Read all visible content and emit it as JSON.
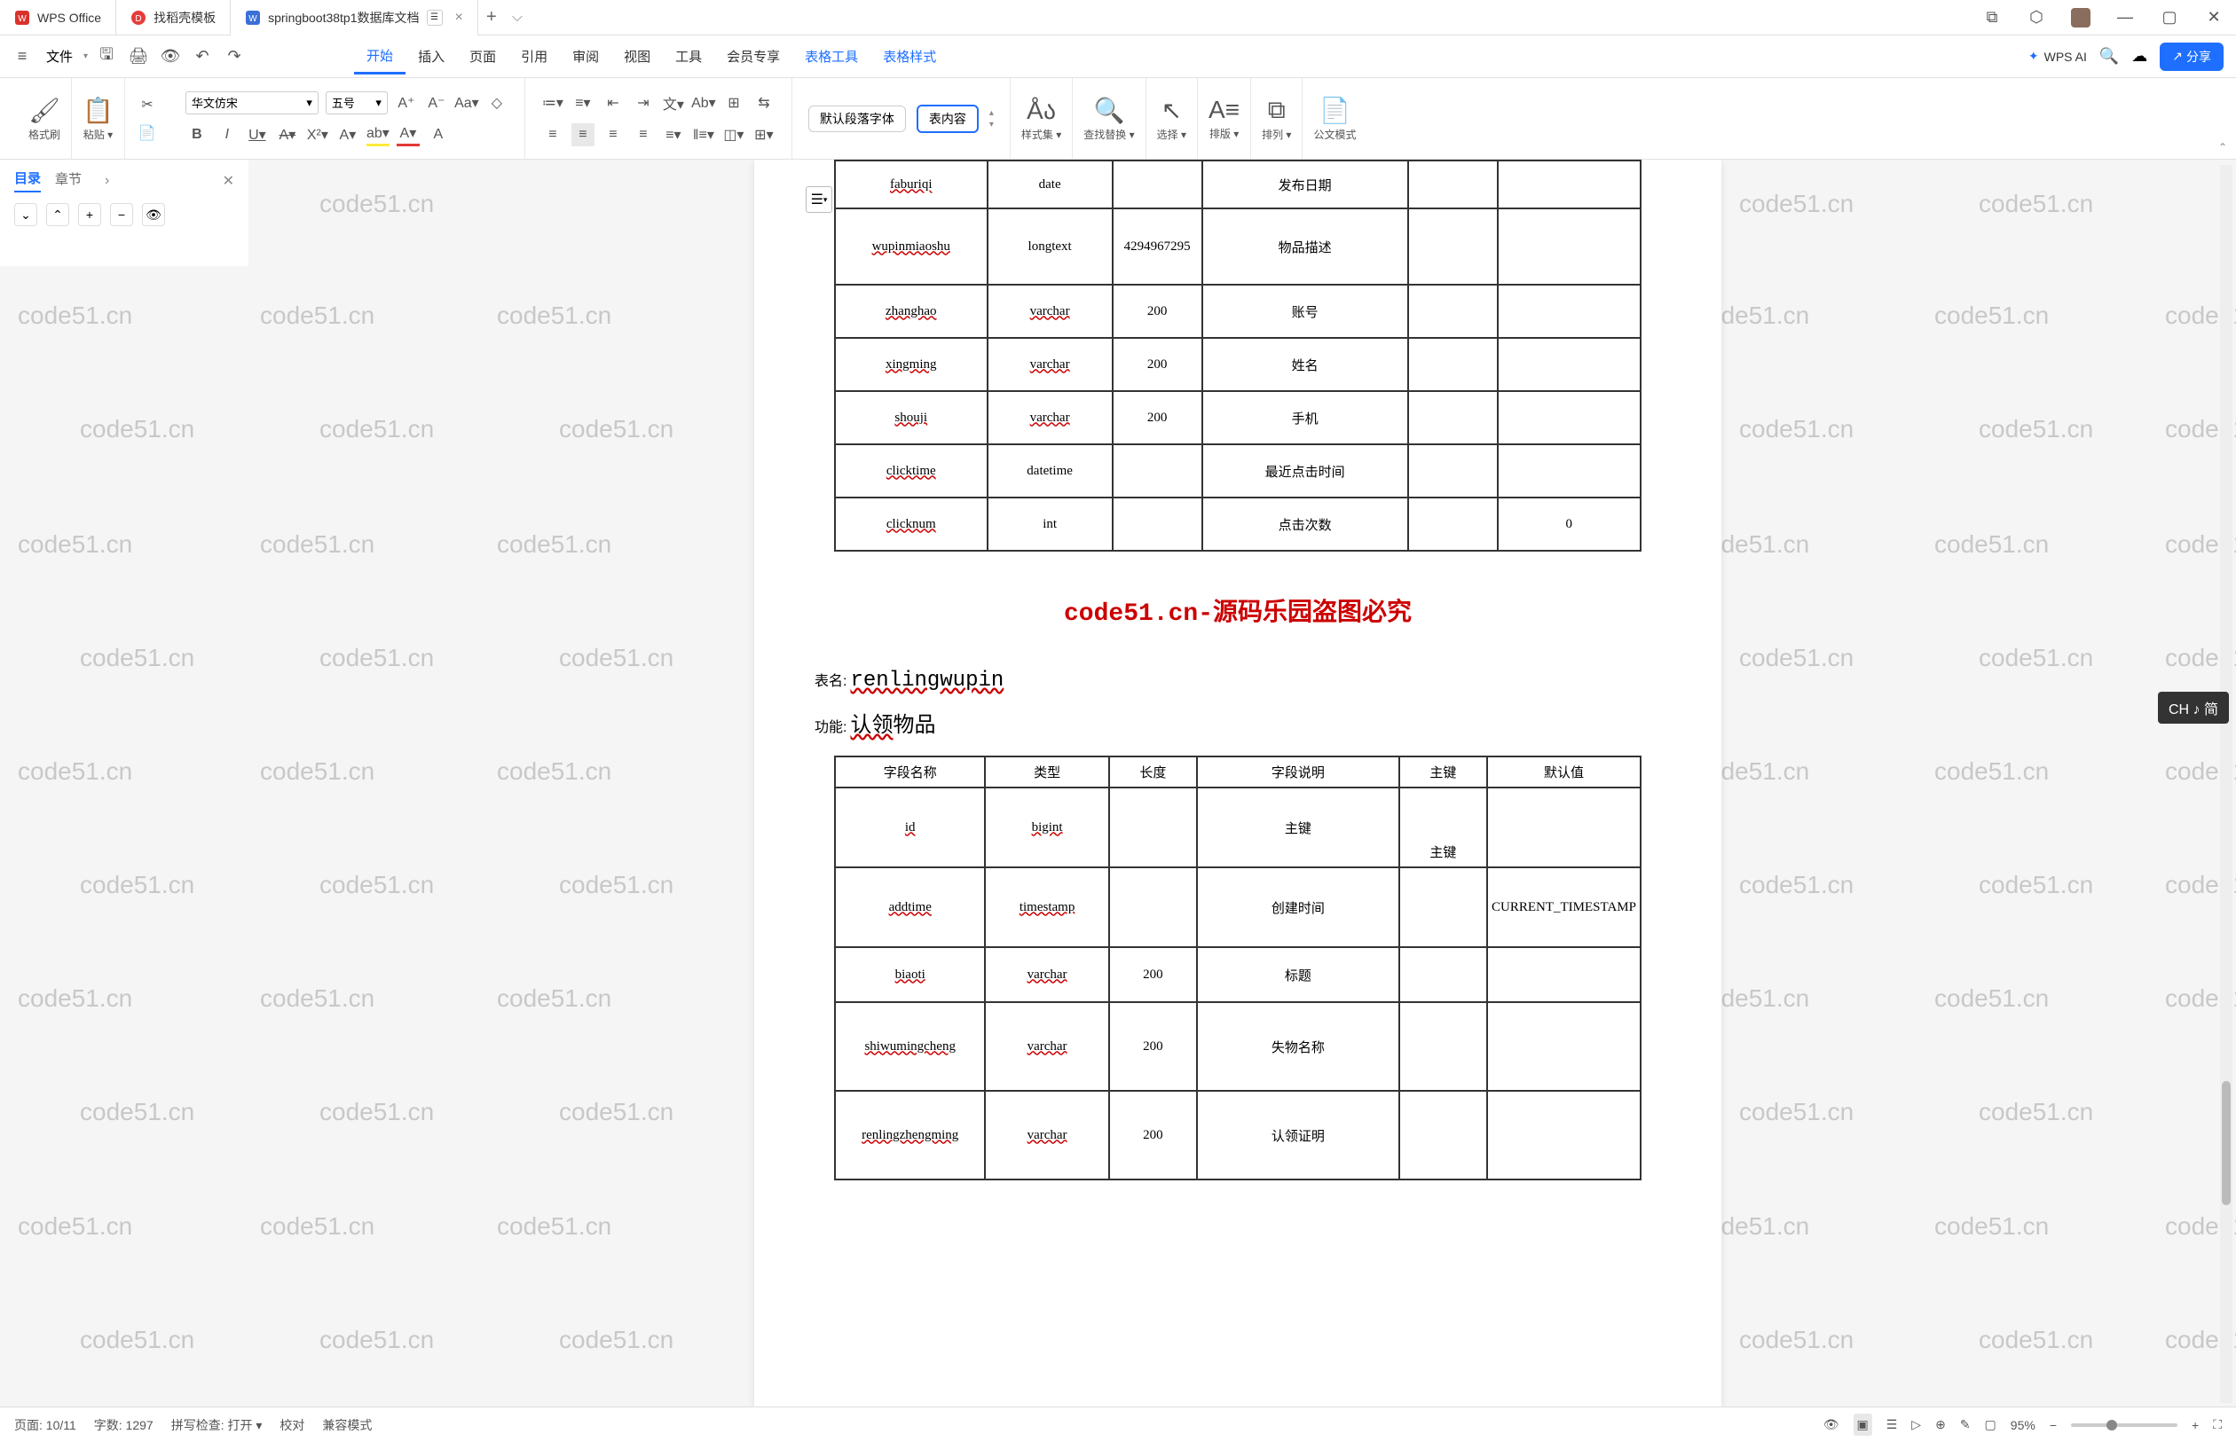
{
  "titlebar": {
    "tabs": [
      {
        "label": "WPS Office",
        "icon": "wps"
      },
      {
        "label": "找稻壳模板",
        "icon": "docer"
      },
      {
        "label": "springboot38tp1数据库文档",
        "icon": "doc",
        "active": true
      }
    ],
    "newTab": "+"
  },
  "menu": {
    "fileLabel": "文件",
    "items": [
      "开始",
      "插入",
      "页面",
      "引用",
      "审阅",
      "视图",
      "工具",
      "会员专享",
      "表格工具",
      "表格样式"
    ],
    "activeIndex": 0,
    "blueIndices": [
      8,
      9
    ],
    "wpsAI": "WPS AI",
    "share": "分享"
  },
  "ribbon": {
    "formatBrush": "格式刷",
    "paste": "粘贴",
    "fontName": "华文仿宋",
    "fontSize": "五号",
    "defaultPara": "默认段落字体",
    "tableContent": "表内容",
    "styleSet": "样式集",
    "findReplace": "查找替换",
    "select": "选择",
    "layout": "排版",
    "arrange": "排列",
    "writingMode": "公文模式"
  },
  "sidepanel": {
    "tabs": [
      "目录",
      "章节"
    ],
    "activeIndex": 0
  },
  "document": {
    "table1": {
      "rows": [
        {
          "name": "faburiqi",
          "type": "date",
          "len": "",
          "desc": "发布日期",
          "pk": "",
          "def": ""
        },
        {
          "name": "wupinmiaoshu",
          "type": "longtext",
          "len": "4294967295",
          "desc": "物品描述",
          "pk": "",
          "def": ""
        },
        {
          "name": "zhanghao",
          "type": "varchar",
          "len": "200",
          "desc": "账号",
          "pk": "",
          "def": ""
        },
        {
          "name": "xingming",
          "type": "varchar",
          "len": "200",
          "desc": "姓名",
          "pk": "",
          "def": ""
        },
        {
          "name": "shouji",
          "type": "varchar",
          "len": "200",
          "desc": "手机",
          "pk": "",
          "def": ""
        },
        {
          "name": "clicktime",
          "type": "datetime",
          "len": "",
          "desc": "最近点击时间",
          "pk": "",
          "def": ""
        },
        {
          "name": "clicknum",
          "type": "int",
          "len": "",
          "desc": "点击次数",
          "pk": "",
          "def": "0"
        }
      ]
    },
    "heading": "code51.cn-源码乐园盗图必究",
    "tableNameLabel": "表名:",
    "tableNameValue": "renlingwupin",
    "funcLabel": "功能:",
    "funcPrefix": "认领",
    "funcSuffix": "物品",
    "table2": {
      "headers": [
        "字段名称",
        "类型",
        "长度",
        "字段说明",
        "主键",
        "默认值"
      ],
      "rows": [
        {
          "name": "id",
          "type": "bigint",
          "len": "",
          "desc": "主键",
          "pk": "主键",
          "def": ""
        },
        {
          "name": "addtime",
          "type": "timestamp",
          "len": "",
          "desc": "创建时间",
          "pk": "",
          "def": "CURRENT_TIMESTAMP"
        },
        {
          "name": "biaoti",
          "type": "varchar",
          "len": "200",
          "desc": "标题",
          "pk": "",
          "def": ""
        },
        {
          "name": "shiwumingcheng",
          "type": "varchar",
          "len": "200",
          "desc": "失物名称",
          "pk": "",
          "def": ""
        },
        {
          "name": "renlingzhengming",
          "type": "varchar",
          "len": "200",
          "desc": "认领证明",
          "pk": "",
          "def": ""
        }
      ]
    }
  },
  "ime": "CH ♪ 简",
  "statusbar": {
    "page": "页面: 10/11",
    "wordCount": "字数: 1297",
    "spellCheck": "拼写检查: 打开",
    "proof": "校对",
    "compat": "兼容模式",
    "zoom": "95%"
  },
  "watermark": "code51.cn"
}
